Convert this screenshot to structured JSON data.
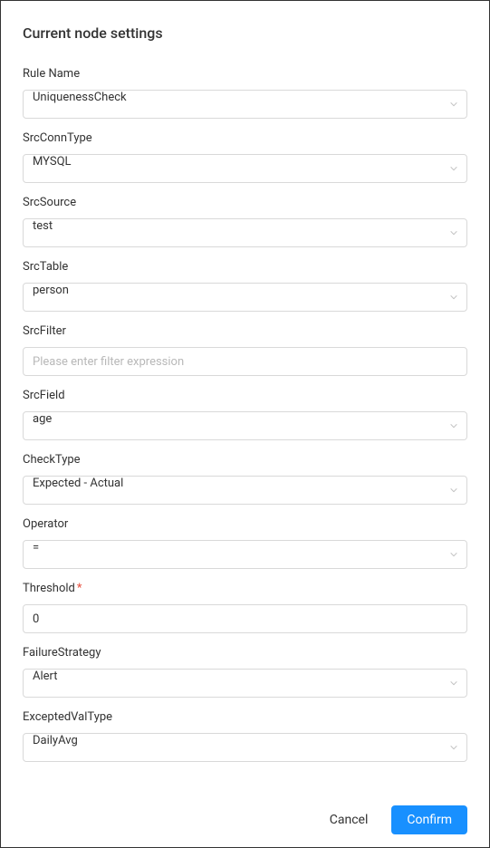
{
  "panel": {
    "title": "Current node settings"
  },
  "form": {
    "ruleName": {
      "label": "Rule Name",
      "value": "UniquenessCheck"
    },
    "srcConnType": {
      "label": "SrcConnType",
      "value": "MYSQL"
    },
    "srcSource": {
      "label": "SrcSource",
      "value": "test"
    },
    "srcTable": {
      "label": "SrcTable",
      "value": "person"
    },
    "srcFilter": {
      "label": "SrcFilter",
      "value": "",
      "placeholder": "Please enter filter expression"
    },
    "srcField": {
      "label": "SrcField",
      "value": "age"
    },
    "checkType": {
      "label": "CheckType",
      "value": "Expected - Actual"
    },
    "operator": {
      "label": "Operator",
      "value": "="
    },
    "threshold": {
      "label": "Threshold",
      "value": "0",
      "required": true
    },
    "failureStrategy": {
      "label": "FailureStrategy",
      "value": "Alert"
    },
    "exceptedValType": {
      "label": "ExceptedValType",
      "value": "DailyAvg"
    }
  },
  "footer": {
    "cancel": "Cancel",
    "confirm": "Confirm"
  }
}
